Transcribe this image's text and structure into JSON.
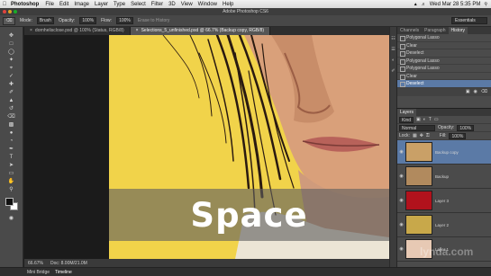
{
  "menubar": {
    "app": "Photoshop",
    "items": [
      "File",
      "Edit",
      "Image",
      "Layer",
      "Type",
      "Select",
      "Filter",
      "3D",
      "View",
      "Window",
      "Help"
    ],
    "clock": "Wed Mar 28  5:35 PM"
  },
  "window": {
    "title": "Adobe Photoshop CS6"
  },
  "options": {
    "mode_label": "Mode:",
    "mode_value": "Brush",
    "opacity_label": "Opacity:",
    "opacity_value": "100%",
    "flow_label": "Flow:",
    "flow_value": "100%",
    "erase_history": "Erase to History",
    "workspace": "Essentials"
  },
  "tabs": [
    {
      "label": "dornhelisclose.psd @ 100% (Status, RGB/8)"
    },
    {
      "label": "Selections_5_unfinished.psd @ 66.7% (Backup copy, RGB/8)"
    }
  ],
  "caption": "Space",
  "status": {
    "zoom": "66.67%",
    "doc": "Doc: 8.00M/21.0M"
  },
  "bottom_tabs": [
    "Mini Bridge",
    "Timeline"
  ],
  "history": {
    "tabs": [
      "Channels",
      "Paragraph",
      "History"
    ],
    "items": [
      "Polygonal Lasso",
      "Clear",
      "Deselect",
      "Polygonal Lasso",
      "Polygonal Lasso",
      "Clear",
      "Deselect"
    ],
    "selected_index": 6
  },
  "layers": {
    "tabs": [
      "Layers"
    ],
    "kind_label": "Kind",
    "blend_mode": "Normal",
    "opacity_label": "Opacity:",
    "opacity_value": "100%",
    "lock_label": "Lock:",
    "fill_label": "Fill:",
    "fill_value": "100%",
    "items": [
      {
        "name": "Backup copy",
        "color": "#c9a067"
      },
      {
        "name": "Backup",
        "color": "#b18a5e"
      },
      {
        "name": "Layer 3",
        "color": "#b1121c"
      },
      {
        "name": "Layer 2",
        "color": "#c8a84a"
      },
      {
        "name": "Layer 1",
        "color": "#e7c9b4"
      }
    ],
    "selected_index": 0
  },
  "watermark": "lynda.com"
}
